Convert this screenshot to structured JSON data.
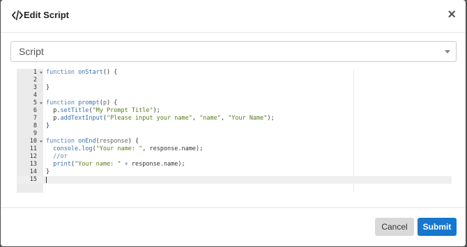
{
  "modal": {
    "title": "Edit Script",
    "close_label": "×",
    "title_icon": "code-icon",
    "close_icon": "close-icon"
  },
  "select": {
    "value": "Script",
    "icon": "chevron-down-icon"
  },
  "editor": {
    "line_numbers": [
      "1",
      "2",
      "3",
      "4",
      "5",
      "6",
      "7",
      "8",
      "9",
      "10",
      "11",
      "12",
      "13",
      "14",
      "15"
    ],
    "fold_lines": [
      1,
      5,
      10
    ],
    "active_line": 15,
    "lines": [
      [
        [
          "kw",
          "function "
        ],
        [
          "fn",
          "onStart"
        ],
        [
          "",
          "() {"
        ]
      ],
      [],
      [
        [
          "",
          "}"
        ]
      ],
      [],
      [
        [
          "kw",
          "function "
        ],
        [
          "fn",
          "prompt"
        ],
        [
          "",
          "("
        ],
        [
          "prm",
          "p"
        ],
        [
          "",
          ") {"
        ]
      ],
      [
        [
          "",
          "  p."
        ],
        [
          "fn",
          "setTitle"
        ],
        [
          "",
          "("
        ],
        [
          "str",
          "\"My Prompt Title\""
        ],
        [
          "",
          ");"
        ]
      ],
      [
        [
          "",
          "  p."
        ],
        [
          "fn",
          "addTextInput"
        ],
        [
          "",
          "("
        ],
        [
          "str",
          "\"Please input your name\""
        ],
        [
          "",
          ", "
        ],
        [
          "str",
          "\"name\""
        ],
        [
          "",
          ", "
        ],
        [
          "str",
          "\"Your Name\""
        ],
        [
          "",
          ");"
        ]
      ],
      [
        [
          "",
          "}"
        ]
      ],
      [],
      [
        [
          "kw",
          "function "
        ],
        [
          "fn",
          "onEnd"
        ],
        [
          "",
          "("
        ],
        [
          "prm",
          "response"
        ],
        [
          "",
          ") {"
        ]
      ],
      [
        [
          "",
          "  "
        ],
        [
          "fn",
          "console"
        ],
        [
          "",
          "."
        ],
        [
          "fn",
          "log"
        ],
        [
          "",
          "("
        ],
        [
          "str",
          "\"Your name: \""
        ],
        [
          "",
          ", response.name);"
        ]
      ],
      [
        [
          "cmt",
          "  //or"
        ]
      ],
      [
        [
          "",
          "  "
        ],
        [
          "fn",
          "print"
        ],
        [
          "",
          "("
        ],
        [
          "str",
          "\"Your name: \""
        ],
        [
          "kw",
          " + "
        ],
        [
          "",
          "response.name);"
        ]
      ],
      [
        [
          "",
          "}"
        ]
      ],
      []
    ]
  },
  "footer": {
    "cancel_label": "Cancel",
    "submit_label": "Submit"
  }
}
